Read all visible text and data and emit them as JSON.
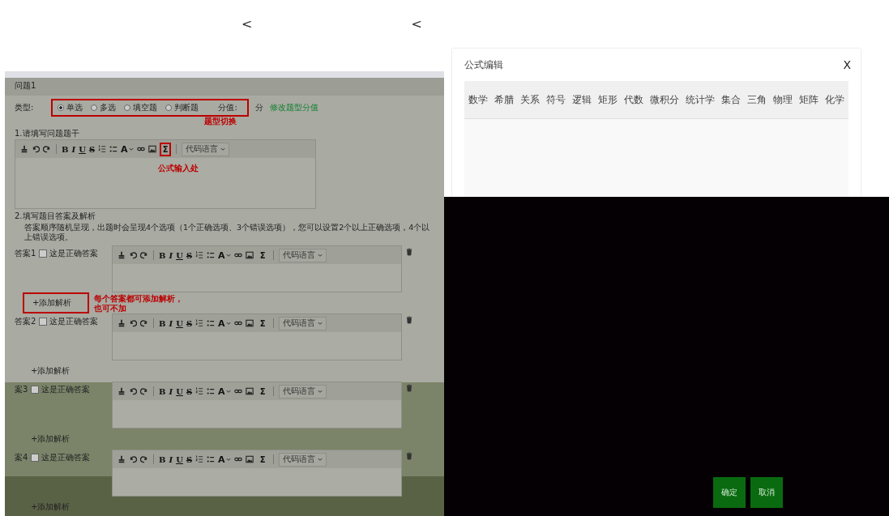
{
  "top_marks": [
    "<",
    "<"
  ],
  "question": {
    "title": "问题1",
    "type_label": "类型:",
    "types": [
      {
        "label": "单选",
        "selected": true
      },
      {
        "label": "多选",
        "selected": false
      },
      {
        "label": "填空题",
        "selected": false
      },
      {
        "label": "判断题",
        "selected": false
      }
    ],
    "score_label": "分值:",
    "score_unit": "分",
    "score_link": "修改题型分值",
    "type_note": "题型切换",
    "stem_heading": "1.请填写问题题干",
    "stem_editor": {
      "tools": [
        "B",
        "I",
        "U",
        "S",
        "A",
        "Σ"
      ],
      "code_language": "代码语言",
      "formula_highlighted": true
    },
    "formula_note": "公式输入处",
    "answers_heading": "2.填写题目答案及解析",
    "answers_hint": "答案顺序随机呈现，出题时会呈现4个选项（1个正确选项、3个错误选项），您可以设置2个以上正确选项，4个以上错误选项。",
    "analysis_note": [
      "每个答案都可添加解析，",
      "也可不加"
    ],
    "answers": [
      {
        "label": "答案1",
        "correct_label": "这是正确答案",
        "checked": false,
        "tools": [
          "B",
          "I",
          "U",
          "S",
          "A",
          "Σ"
        ],
        "code_language": "代码语言",
        "add_analysis": "+添加解析",
        "highlighted": true
      },
      {
        "label": "答案2",
        "correct_label": "这是正确答案",
        "checked": false,
        "tools": [
          "B",
          "I",
          "U",
          "S",
          "A",
          "Σ"
        ],
        "code_language": "代码语言",
        "add_analysis": "+添加解析",
        "highlighted": false
      },
      {
        "label": "案3",
        "correct_label": "这是正确答案",
        "checked": false,
        "tools": [
          "B",
          "I",
          "U",
          "S",
          "A",
          "Σ"
        ],
        "code_language": "代码语言",
        "add_analysis": "+添加解析",
        "highlighted": false
      },
      {
        "label": "案4",
        "correct_label": "这是正确答案",
        "checked": false,
        "tools": [
          "B",
          "I",
          "U",
          "S",
          "A",
          "Σ"
        ],
        "code_language": "代码语言",
        "add_analysis": "+添加解析",
        "highlighted": false
      }
    ]
  },
  "formula_dialog": {
    "title": "公式编辑",
    "close": "X",
    "tabs": [
      "数学",
      "希腊",
      "关系",
      "符号",
      "逻辑",
      "矩形",
      "代数",
      "微积分",
      "统计学",
      "集合",
      "三角",
      "物理",
      "矩阵",
      "化学"
    ],
    "buttons": [
      "确定",
      "取消"
    ]
  }
}
